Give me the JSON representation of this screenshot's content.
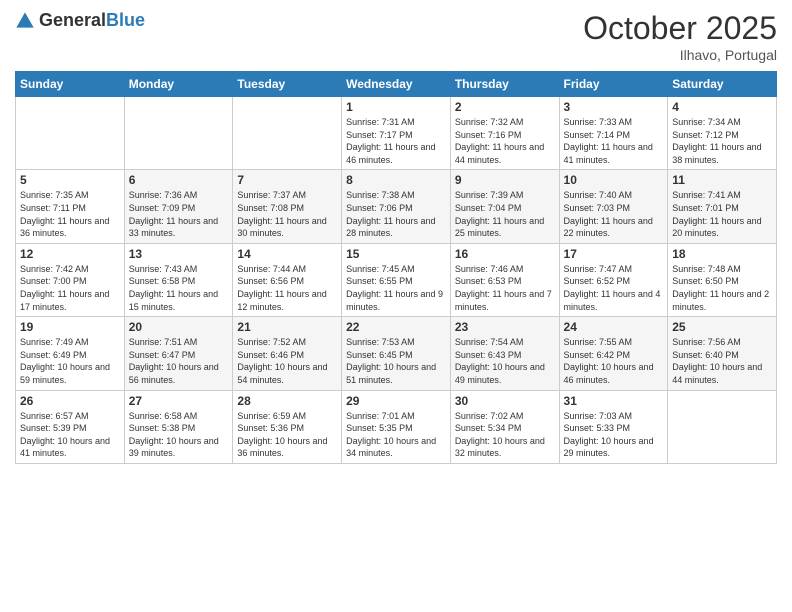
{
  "header": {
    "logo_general": "General",
    "logo_blue": "Blue",
    "month": "October 2025",
    "location": "Ilhavo, Portugal"
  },
  "days_of_week": [
    "Sunday",
    "Monday",
    "Tuesday",
    "Wednesday",
    "Thursday",
    "Friday",
    "Saturday"
  ],
  "weeks": [
    [
      {
        "day": "",
        "info": ""
      },
      {
        "day": "",
        "info": ""
      },
      {
        "day": "",
        "info": ""
      },
      {
        "day": "1",
        "info": "Sunrise: 7:31 AM\nSunset: 7:17 PM\nDaylight: 11 hours and 46 minutes."
      },
      {
        "day": "2",
        "info": "Sunrise: 7:32 AM\nSunset: 7:16 PM\nDaylight: 11 hours and 44 minutes."
      },
      {
        "day": "3",
        "info": "Sunrise: 7:33 AM\nSunset: 7:14 PM\nDaylight: 11 hours and 41 minutes."
      },
      {
        "day": "4",
        "info": "Sunrise: 7:34 AM\nSunset: 7:12 PM\nDaylight: 11 hours and 38 minutes."
      }
    ],
    [
      {
        "day": "5",
        "info": "Sunrise: 7:35 AM\nSunset: 7:11 PM\nDaylight: 11 hours and 36 minutes."
      },
      {
        "day": "6",
        "info": "Sunrise: 7:36 AM\nSunset: 7:09 PM\nDaylight: 11 hours and 33 minutes."
      },
      {
        "day": "7",
        "info": "Sunrise: 7:37 AM\nSunset: 7:08 PM\nDaylight: 11 hours and 30 minutes."
      },
      {
        "day": "8",
        "info": "Sunrise: 7:38 AM\nSunset: 7:06 PM\nDaylight: 11 hours and 28 minutes."
      },
      {
        "day": "9",
        "info": "Sunrise: 7:39 AM\nSunset: 7:04 PM\nDaylight: 11 hours and 25 minutes."
      },
      {
        "day": "10",
        "info": "Sunrise: 7:40 AM\nSunset: 7:03 PM\nDaylight: 11 hours and 22 minutes."
      },
      {
        "day": "11",
        "info": "Sunrise: 7:41 AM\nSunset: 7:01 PM\nDaylight: 11 hours and 20 minutes."
      }
    ],
    [
      {
        "day": "12",
        "info": "Sunrise: 7:42 AM\nSunset: 7:00 PM\nDaylight: 11 hours and 17 minutes."
      },
      {
        "day": "13",
        "info": "Sunrise: 7:43 AM\nSunset: 6:58 PM\nDaylight: 11 hours and 15 minutes."
      },
      {
        "day": "14",
        "info": "Sunrise: 7:44 AM\nSunset: 6:56 PM\nDaylight: 11 hours and 12 minutes."
      },
      {
        "day": "15",
        "info": "Sunrise: 7:45 AM\nSunset: 6:55 PM\nDaylight: 11 hours and 9 minutes."
      },
      {
        "day": "16",
        "info": "Sunrise: 7:46 AM\nSunset: 6:53 PM\nDaylight: 11 hours and 7 minutes."
      },
      {
        "day": "17",
        "info": "Sunrise: 7:47 AM\nSunset: 6:52 PM\nDaylight: 11 hours and 4 minutes."
      },
      {
        "day": "18",
        "info": "Sunrise: 7:48 AM\nSunset: 6:50 PM\nDaylight: 11 hours and 2 minutes."
      }
    ],
    [
      {
        "day": "19",
        "info": "Sunrise: 7:49 AM\nSunset: 6:49 PM\nDaylight: 10 hours and 59 minutes."
      },
      {
        "day": "20",
        "info": "Sunrise: 7:51 AM\nSunset: 6:47 PM\nDaylight: 10 hours and 56 minutes."
      },
      {
        "day": "21",
        "info": "Sunrise: 7:52 AM\nSunset: 6:46 PM\nDaylight: 10 hours and 54 minutes."
      },
      {
        "day": "22",
        "info": "Sunrise: 7:53 AM\nSunset: 6:45 PM\nDaylight: 10 hours and 51 minutes."
      },
      {
        "day": "23",
        "info": "Sunrise: 7:54 AM\nSunset: 6:43 PM\nDaylight: 10 hours and 49 minutes."
      },
      {
        "day": "24",
        "info": "Sunrise: 7:55 AM\nSunset: 6:42 PM\nDaylight: 10 hours and 46 minutes."
      },
      {
        "day": "25",
        "info": "Sunrise: 7:56 AM\nSunset: 6:40 PM\nDaylight: 10 hours and 44 minutes."
      }
    ],
    [
      {
        "day": "26",
        "info": "Sunrise: 6:57 AM\nSunset: 5:39 PM\nDaylight: 10 hours and 41 minutes."
      },
      {
        "day": "27",
        "info": "Sunrise: 6:58 AM\nSunset: 5:38 PM\nDaylight: 10 hours and 39 minutes."
      },
      {
        "day": "28",
        "info": "Sunrise: 6:59 AM\nSunset: 5:36 PM\nDaylight: 10 hours and 36 minutes."
      },
      {
        "day": "29",
        "info": "Sunrise: 7:01 AM\nSunset: 5:35 PM\nDaylight: 10 hours and 34 minutes."
      },
      {
        "day": "30",
        "info": "Sunrise: 7:02 AM\nSunset: 5:34 PM\nDaylight: 10 hours and 32 minutes."
      },
      {
        "day": "31",
        "info": "Sunrise: 7:03 AM\nSunset: 5:33 PM\nDaylight: 10 hours and 29 minutes."
      },
      {
        "day": "",
        "info": ""
      }
    ]
  ]
}
